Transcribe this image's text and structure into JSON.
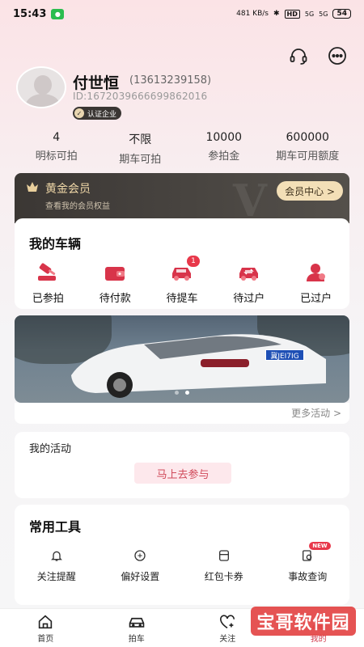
{
  "status": {
    "time": "15:43",
    "net_speed": "481 KB/s",
    "hd": "HD",
    "sig1": "5G",
    "sig2": "5G",
    "battery": "54"
  },
  "profile": {
    "name": "付世恒",
    "phone": "(13613239158)",
    "id": "ID:16720396669986201​6",
    "badge": "认证企业"
  },
  "stats": [
    {
      "value": "4",
      "label": "明标可拍"
    },
    {
      "value": "不限",
      "label": "期车可拍"
    },
    {
      "value": "10000",
      "label": "参拍金"
    },
    {
      "value": "600000",
      "label": "期车可用额度"
    }
  ],
  "vip": {
    "title": "黄金会员",
    "subtitle": "查看我的会员权益",
    "watermark": "V",
    "center_btn": "会员中心 >"
  },
  "vehicles": {
    "title": "我的车辆",
    "items": [
      {
        "label": "已参拍",
        "icon": "gavel-icon"
      },
      {
        "label": "待付款",
        "icon": "wallet-icon"
      },
      {
        "label": "待提车",
        "icon": "car-pickup-icon",
        "badge": "1"
      },
      {
        "label": "待过户",
        "icon": "car-transfer-icon"
      },
      {
        "label": "已过户",
        "icon": "user-done-icon"
      }
    ]
  },
  "banner": {
    "plate": "冀JEI7IG",
    "more": "更多活动 >"
  },
  "activity": {
    "title": "我的活动",
    "button": "马上去参与"
  },
  "tools": {
    "title": "常用工具",
    "items": [
      {
        "label": "关注提醒",
        "icon": "bell-icon"
      },
      {
        "label": "偏好设置",
        "icon": "preference-icon"
      },
      {
        "label": "红包卡券",
        "icon": "coupon-icon"
      },
      {
        "label": "事故查询",
        "icon": "search-doc-icon",
        "tag": "NEW"
      }
    ]
  },
  "tabbar": [
    {
      "label": "首页",
      "icon": "home-icon"
    },
    {
      "label": "拍车",
      "icon": "car-icon"
    },
    {
      "label": "关注",
      "icon": "heart-plus-icon"
    },
    {
      "label": "我的",
      "icon": "user-icon",
      "active": true
    }
  ],
  "watermark_text": "宝哥软件园",
  "colors": {
    "accent": "#d0384a",
    "vip_bg": "#3b3734",
    "vip_gold": "#f0d8a8"
  }
}
